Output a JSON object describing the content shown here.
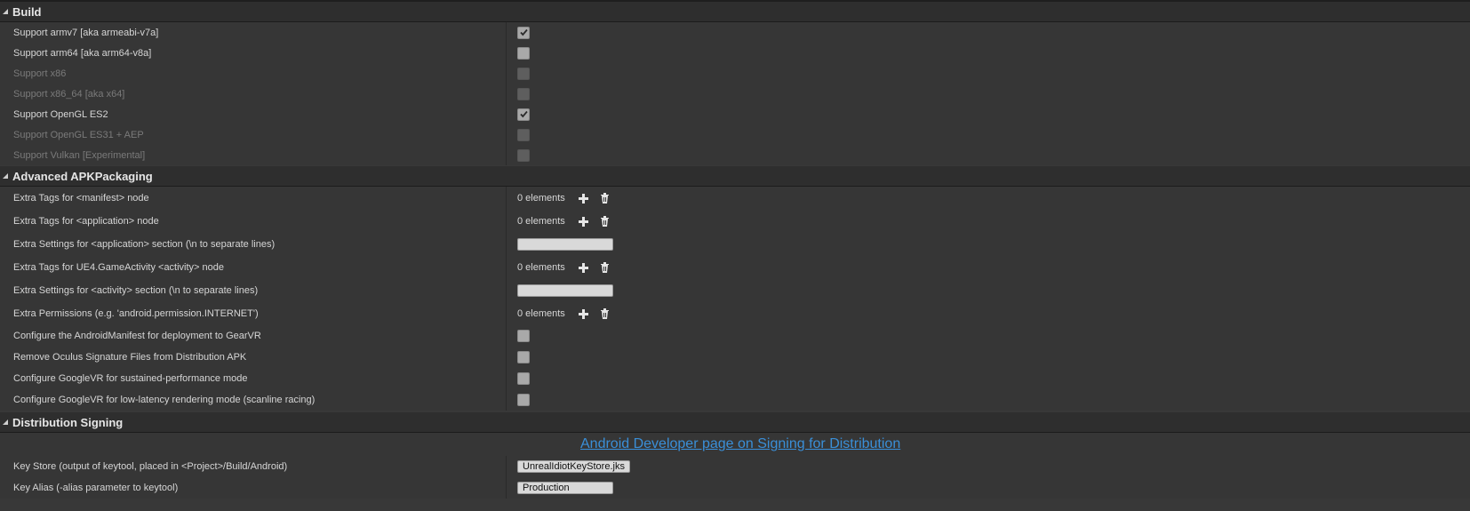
{
  "sections": {
    "build": {
      "title": "Build",
      "rows": [
        {
          "label": "Support armv7 [aka armeabi-v7a]",
          "checked": true,
          "enabled": true
        },
        {
          "label": "Support arm64 [aka arm64-v8a]",
          "checked": false,
          "enabled": true
        },
        {
          "label": "Support x86",
          "checked": false,
          "enabled": false
        },
        {
          "label": "Support x86_64 [aka x64]",
          "checked": false,
          "enabled": false
        },
        {
          "label": "Support OpenGL ES2",
          "checked": true,
          "enabled": true
        },
        {
          "label": "Support OpenGL ES31 + AEP",
          "checked": false,
          "enabled": false
        },
        {
          "label": "Support Vulkan [Experimental]",
          "checked": false,
          "enabled": false
        }
      ]
    },
    "apk": {
      "title": "Advanced APKPackaging",
      "manifest_tags": {
        "label": "Extra Tags for <manifest> node",
        "count": "0 elements"
      },
      "application_tags": {
        "label": "Extra Tags for <application> node",
        "count": "0 elements"
      },
      "application_settings": {
        "label": "Extra Settings for <application> section (\\n to separate lines)",
        "value": ""
      },
      "activity_tags": {
        "label": "Extra Tags for UE4.GameActivity <activity> node",
        "count": "0 elements"
      },
      "activity_settings": {
        "label": "Extra Settings for <activity> section (\\n to separate lines)",
        "value": ""
      },
      "permissions": {
        "label": "Extra Permissions (e.g. 'android.permission.INTERNET')",
        "count": "0 elements"
      },
      "gearvr_manifest": {
        "label": "Configure the AndroidManifest for deployment to GearVR",
        "checked": false
      },
      "oculus_signature": {
        "label": "Remove Oculus Signature Files from Distribution APK",
        "checked": false
      },
      "googlevr_sustained": {
        "label": "Configure GoogleVR for sustained-performance mode",
        "checked": false
      },
      "googlevr_lowlatency": {
        "label": "Configure GoogleVR for low-latency rendering mode (scanline racing)",
        "checked": false
      }
    },
    "signing": {
      "title": "Distribution Signing",
      "link": "Android Developer page on Signing for Distribution",
      "key_store": {
        "label": "Key Store (output of keytool, placed in <Project>/Build/Android)",
        "value": "UnrealIdiotKeyStore.jks"
      },
      "key_alias": {
        "label": "Key Alias (-alias parameter to keytool)",
        "value": "Production"
      }
    }
  },
  "icons": {
    "add": "plus-icon",
    "delete": "trash-icon",
    "check": "checkmark-icon",
    "collapse": "triangle-collapse-icon"
  },
  "colors": {
    "link": "#3a8fd8",
    "background": "#383838",
    "header": "#2e2e2e"
  }
}
